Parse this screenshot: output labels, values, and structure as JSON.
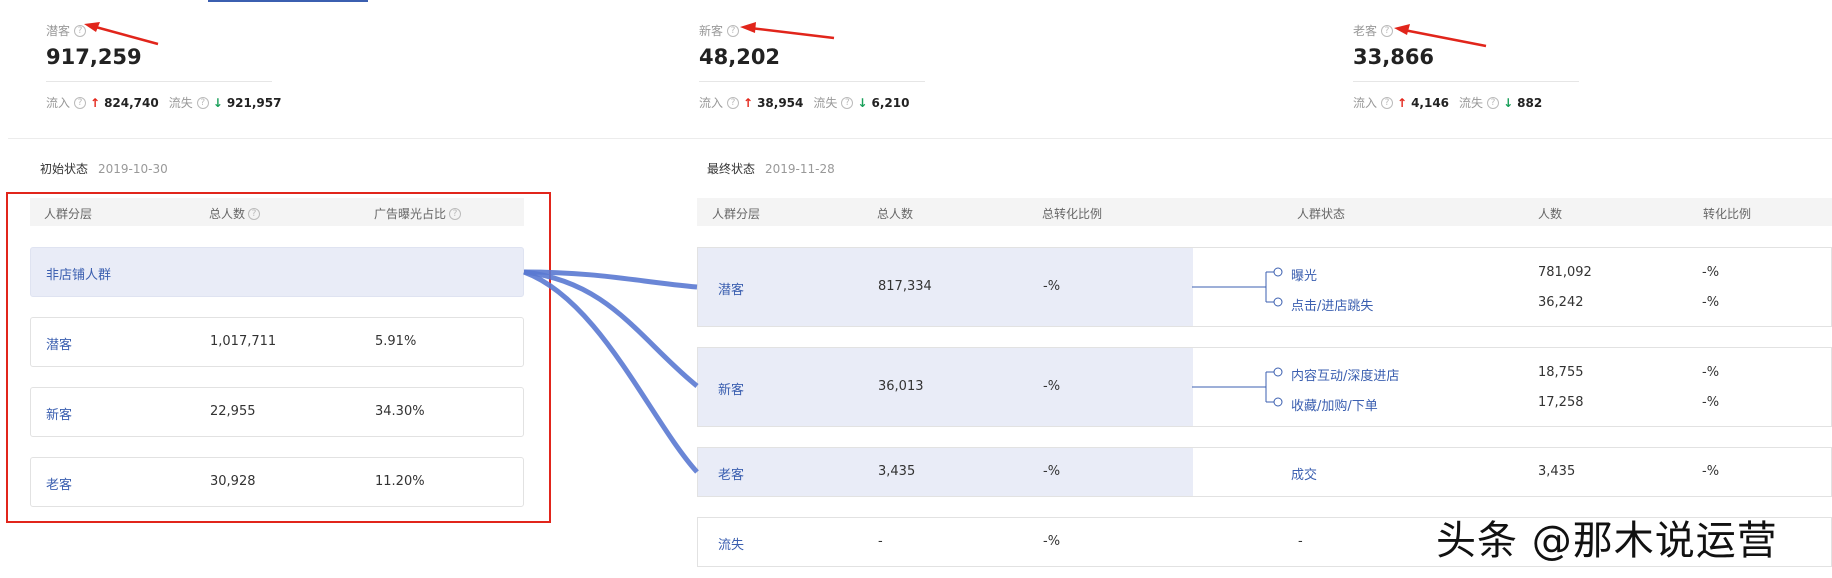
{
  "summary": [
    {
      "label": "潜客",
      "value": "917,259",
      "inflow_label": "流入",
      "inflow": "824,740",
      "outflow_label": "流失",
      "outflow": "921,957"
    },
    {
      "label": "新客",
      "value": "48,202",
      "inflow_label": "流入",
      "inflow": "38,954",
      "outflow_label": "流失",
      "outflow": "6,210"
    },
    {
      "label": "老客",
      "value": "33,866",
      "inflow_label": "流入",
      "inflow": "4,146",
      "outflow_label": "流失",
      "outflow": "882"
    }
  ],
  "initial": {
    "title": "初始状态",
    "date": "2019-10-30",
    "headers": [
      "人群分层",
      "总人数",
      "广告曝光占比"
    ],
    "rows": [
      {
        "name": "非店铺人群",
        "total": "",
        "ratio": ""
      },
      {
        "name": "潜客",
        "total": "1,017,711",
        "ratio": "5.91%"
      },
      {
        "name": "新客",
        "total": "22,955",
        "ratio": "34.30%"
      },
      {
        "name": "老客",
        "total": "30,928",
        "ratio": "11.20%"
      }
    ]
  },
  "final": {
    "title": "最终状态",
    "date": "2019-11-28",
    "headers": [
      "人群分层",
      "总人数",
      "总转化比例",
      "人群状态",
      "人数",
      "转化比例"
    ],
    "rows": [
      {
        "name": "潜客",
        "total": "817,334",
        "rate": "-%",
        "subs": [
          {
            "label": "曝光",
            "count": "781,092",
            "rate": "-%"
          },
          {
            "label": "点击/进店跳失",
            "count": "36,242",
            "rate": "-%"
          }
        ]
      },
      {
        "name": "新客",
        "total": "36,013",
        "rate": "-%",
        "subs": [
          {
            "label": "内容互动/深度进店",
            "count": "18,755",
            "rate": "-%"
          },
          {
            "label": "收藏/加购/下单",
            "count": "17,258",
            "rate": "-%"
          }
        ]
      },
      {
        "name": "老客",
        "total": "3,435",
        "rate": "-%",
        "subs": [
          {
            "label": "成交",
            "count": "3,435",
            "rate": "-%"
          }
        ]
      },
      {
        "name": "流失",
        "total": "-",
        "rate": "-%",
        "subs": [
          {
            "label": "-",
            "count": "",
            "rate": ""
          }
        ]
      }
    ]
  },
  "colors": {
    "accent": "#3b5fb0",
    "flow": "#5a79d1",
    "annotation": "#e1251b",
    "up": "#e3261b",
    "down": "#19a05a"
  },
  "icons": {
    "help": "question-circle-icon",
    "up": "arrow-up-icon",
    "down": "arrow-down-icon"
  },
  "watermark": "头条 @那木说运营"
}
